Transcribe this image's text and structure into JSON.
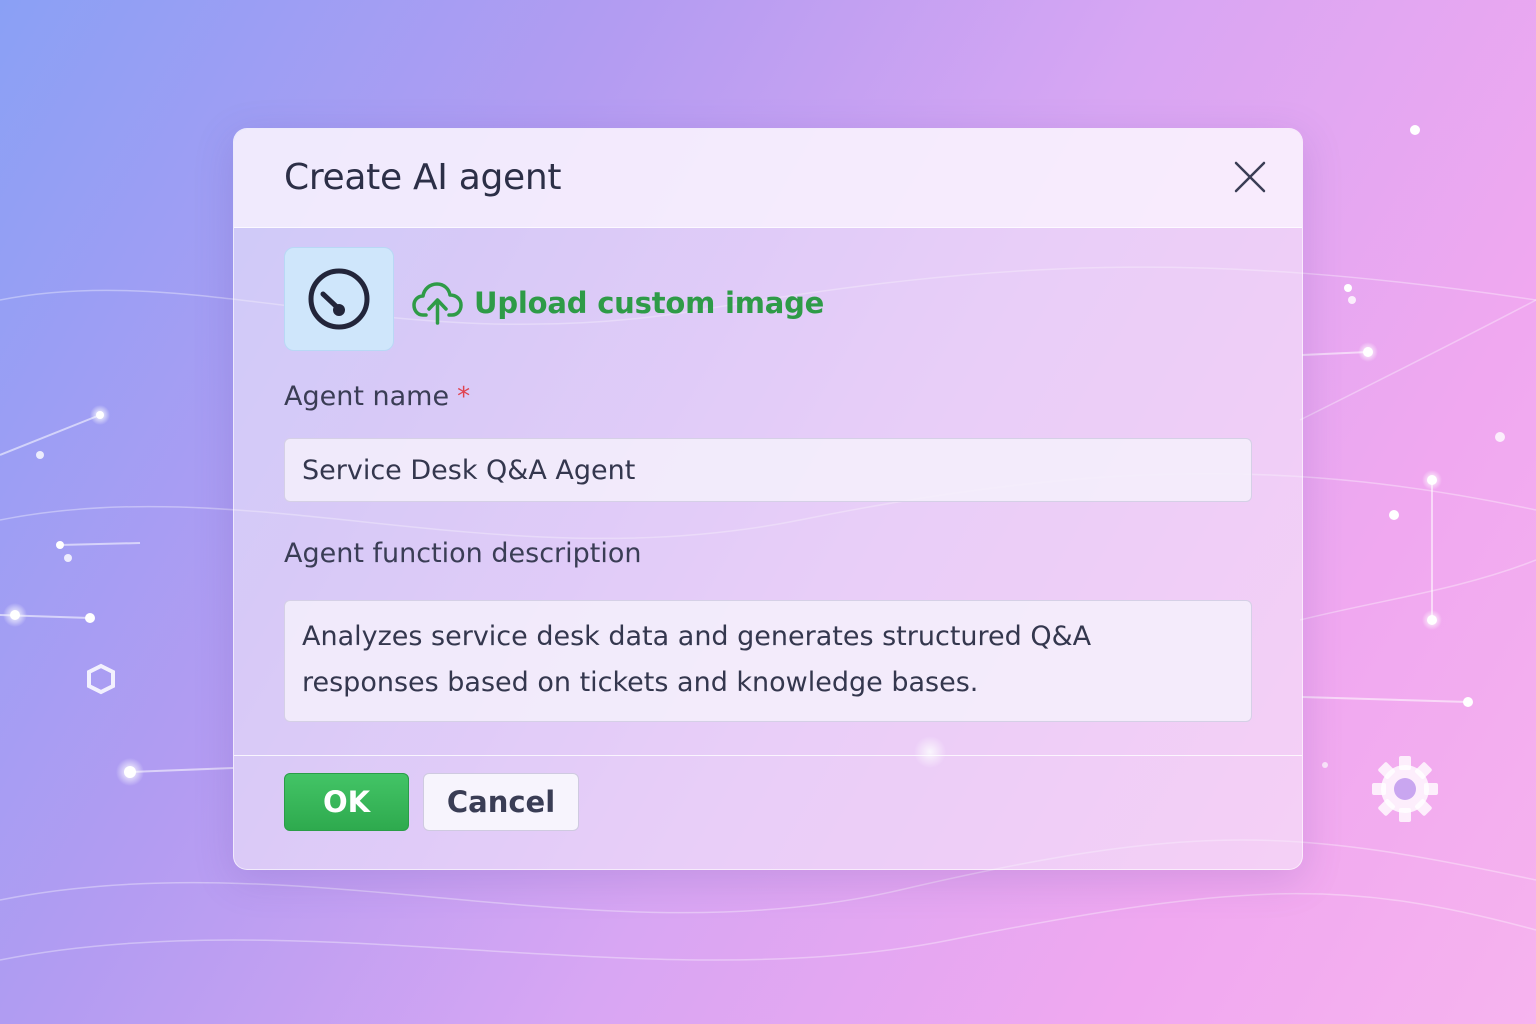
{
  "dialog": {
    "title": "Create AI agent",
    "close_icon": "close-icon",
    "avatar_icon": "gauge-icon",
    "upload_icon": "cloud-upload-icon",
    "upload_label": "Upload custom image",
    "fields": {
      "name": {
        "label": "Agent name",
        "required_marker": "*",
        "value": "Service Desk Q&A Agent"
      },
      "description": {
        "label": "Agent function description",
        "value": "Analyzes service desk data and generates structured Q&A responses based on tickets and knowledge bases."
      }
    },
    "buttons": {
      "ok_label": "OK",
      "cancel_label": "Cancel"
    }
  },
  "colors": {
    "accent_green": "#2e9b47",
    "ok_button": "#38b55a",
    "required": "#e0434f",
    "avatar_bg": "#cfe6fb",
    "title_text": "#2c2f47"
  },
  "background_icons": [
    "hexagon-icon",
    "gear-icon"
  ]
}
